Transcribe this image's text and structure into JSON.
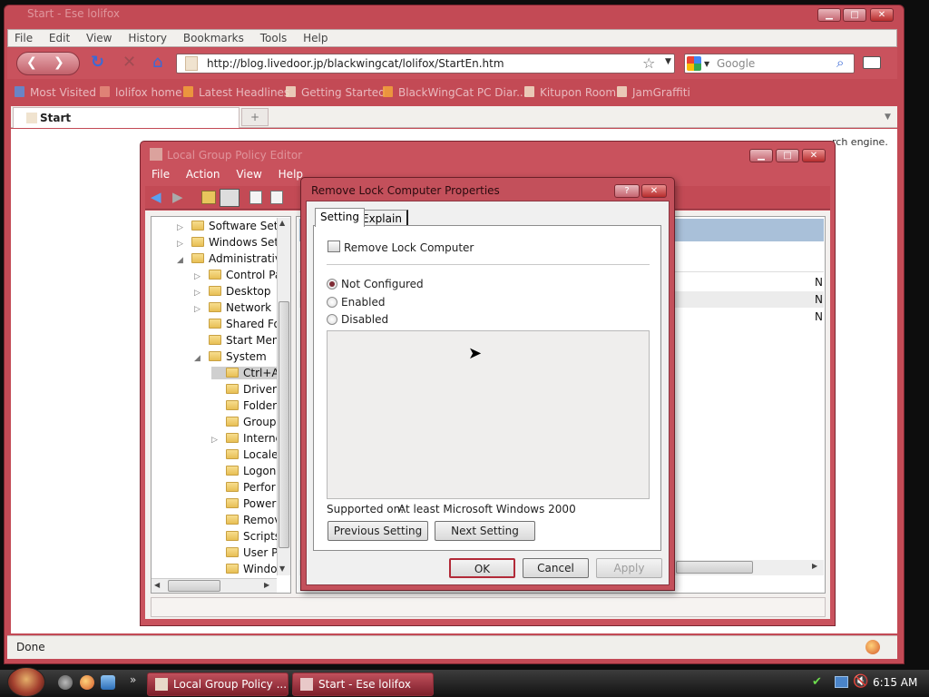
{
  "browser": {
    "title": "Start - Ese lolifox",
    "menu": [
      "File",
      "Edit",
      "View",
      "History",
      "Bookmarks",
      "Tools",
      "Help"
    ],
    "url": "http://blog.livedoor.jp/blackwingcat/lolifox/StartEn.htm",
    "search_placeholder": "Google",
    "bookmarks": [
      "Most Visited",
      "lolifox home",
      "Latest Headlines",
      "Getting Started",
      "BlackWingCat PC Diar...",
      "Kitupon Room",
      "JamGraffiti"
    ],
    "tab_label": "Start",
    "new_tab": "+",
    "info_fragment": "rch engine.",
    "status": "Done"
  },
  "gpe": {
    "title": "Local Group Policy Editor",
    "menu": [
      "File",
      "Action",
      "View",
      "Help"
    ],
    "tree": [
      {
        "label": "Software Setti",
        "expander": "▷",
        "level": 0
      },
      {
        "label": "Windows Sett",
        "expander": "▷",
        "level": 0
      },
      {
        "label": "Administrative",
        "expander": "◢",
        "level": 0
      },
      {
        "label": "Control Pa",
        "expander": "▷",
        "level": 1
      },
      {
        "label": "Desktop",
        "expander": "▷",
        "level": 1
      },
      {
        "label": "Network",
        "expander": "▷",
        "level": 1
      },
      {
        "label": "Shared Fol",
        "expander": "",
        "level": 1
      },
      {
        "label": "Start Menu",
        "expander": "",
        "level": 1
      },
      {
        "label": "System",
        "expander": "◢",
        "level": 1
      },
      {
        "label": "Ctrl+A",
        "expander": "",
        "level": 2
      },
      {
        "label": "Driver",
        "expander": "",
        "level": 2
      },
      {
        "label": "Folder",
        "expander": "",
        "level": 2
      },
      {
        "label": "Group",
        "expander": "",
        "level": 2
      },
      {
        "label": "Interne",
        "expander": "▷",
        "level": 2
      },
      {
        "label": "Locale",
        "expander": "",
        "level": 2
      },
      {
        "label": "Logon",
        "expander": "",
        "level": 2
      },
      {
        "label": "Perfor",
        "expander": "",
        "level": 2
      },
      {
        "label": "Power",
        "expander": "",
        "level": 2
      },
      {
        "label": "Remov",
        "expander": "",
        "level": 2
      },
      {
        "label": "Scripts",
        "expander": "",
        "level": 2
      },
      {
        "label": "User Pr",
        "expander": "",
        "level": 2
      },
      {
        "label": "Windo",
        "expander": "",
        "level": 2
      }
    ],
    "state_cells": [
      "N",
      "N",
      "N"
    ]
  },
  "dialog": {
    "title": "Remove Lock Computer Properties",
    "help": "?",
    "close": "✕",
    "tabs": [
      "Setting",
      "Explain"
    ],
    "policy_name": "Remove Lock Computer",
    "options": [
      {
        "label": "Not Configured",
        "selected": true
      },
      {
        "label": "Enabled",
        "selected": false
      },
      {
        "label": "Disabled",
        "selected": false
      }
    ],
    "supported_label": "Supported on:",
    "supported_value": "At least Microsoft Windows 2000",
    "prev_button": "Previous Setting",
    "next_button": "Next Setting",
    "ok": "OK",
    "cancel": "Cancel",
    "apply": "Apply"
  },
  "taskbar": {
    "items": [
      "Local Group Policy ...",
      "Start - Ese lolifox"
    ],
    "quicklaunch_more": "»",
    "clock": "6:15 AM"
  },
  "colors": {
    "frame": "#c34a55",
    "frame_dark": "#7a2530",
    "tree_header": "#a9c0d9"
  }
}
